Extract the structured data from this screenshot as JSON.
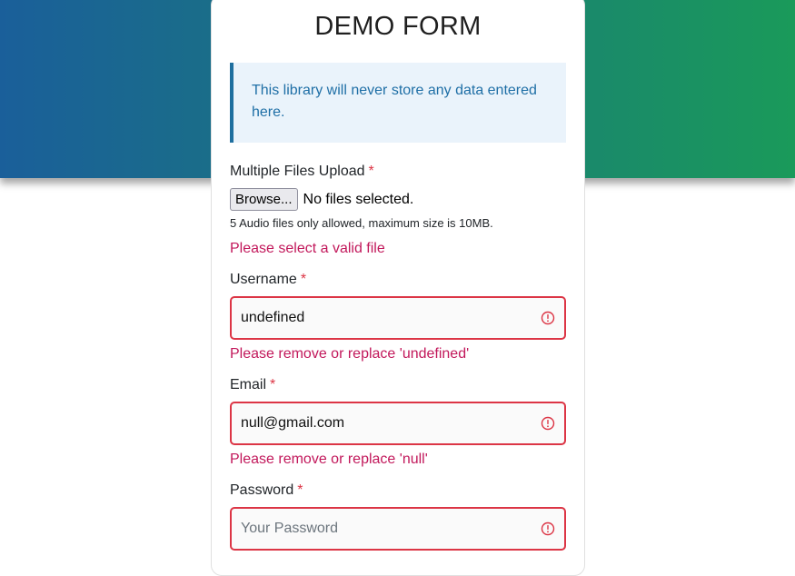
{
  "form": {
    "title": "DEMO FORM",
    "notice": "This library will never store any data entered here.",
    "files": {
      "label": "Multiple Files Upload",
      "required_mark": "*",
      "browse_label": "Browse...",
      "status": "No files selected.",
      "hint": "5 Audio files only allowed, maximum size is 10MB.",
      "error": "Please select a valid file"
    },
    "username": {
      "label": "Username",
      "required_mark": "*",
      "value": "undefined",
      "error": "Please remove or replace 'undefined'"
    },
    "email": {
      "label": "Email",
      "required_mark": "*",
      "value": "null@gmail.com",
      "error": "Please remove or replace 'null'"
    },
    "password": {
      "label": "Password",
      "required_mark": "*",
      "placeholder": "Your Password",
      "value": ""
    }
  },
  "colors": {
    "error": "#dc3545",
    "error_text": "#c2185b",
    "notice_text": "#1f6fa6",
    "notice_border": "#1f6f9f",
    "banner_start": "#1a5f9a",
    "banner_end": "#1a9a5a"
  },
  "icons": {
    "field_error": "exclamation-circle-icon"
  }
}
